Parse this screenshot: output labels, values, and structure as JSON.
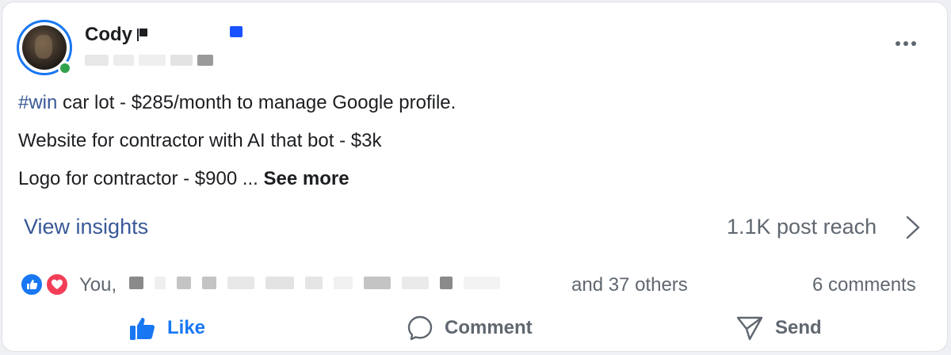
{
  "post": {
    "author": "Cody",
    "line1_hashtag": "#win",
    "line1_rest": " car lot - $285/month to manage Google profile.",
    "line2": "Website for contractor with AI that bot - $3k",
    "line3": "Logo for contractor - $900 ... ",
    "see_more": "See more"
  },
  "insights": {
    "link": "View insights",
    "reach": "1.1K post reach"
  },
  "reactions": {
    "names_start": "You,",
    "others": "and 37 others",
    "comments": "6 comments",
    "icons": [
      "like-icon",
      "love-icon"
    ]
  },
  "actions": {
    "like": "Like",
    "comment": "Comment",
    "send": "Send"
  },
  "colors": {
    "accent_blue": "#1877f2",
    "link_blue": "#385898",
    "secondary_text": "#606770",
    "online_green": "#31a24c",
    "love_red": "#f33e58"
  }
}
